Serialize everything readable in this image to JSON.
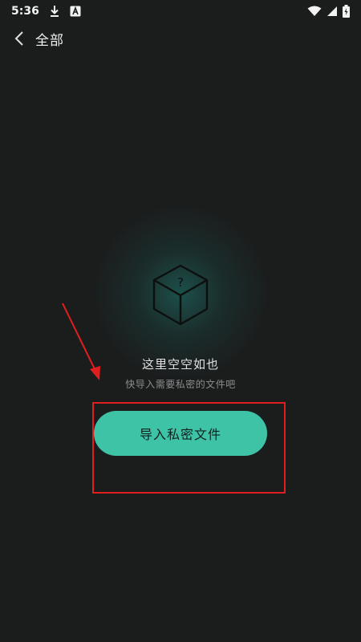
{
  "status_bar": {
    "time": "5:36",
    "icons": [
      "download-icon",
      "app-notification-icon",
      "wifi-icon",
      "signal-icon",
      "battery-icon"
    ]
  },
  "header": {
    "back_icon": "chevron-left-icon",
    "title": "全部"
  },
  "empty_state": {
    "icon": "question-box-icon",
    "title": "这里空空如也",
    "subtitle": "快导入需要私密的文件吧"
  },
  "import_button": {
    "label": "导入私密文件"
  },
  "colors": {
    "background": "#1b1d1d",
    "accent": "#3ec3a7",
    "annotation": "#e01e1e"
  }
}
